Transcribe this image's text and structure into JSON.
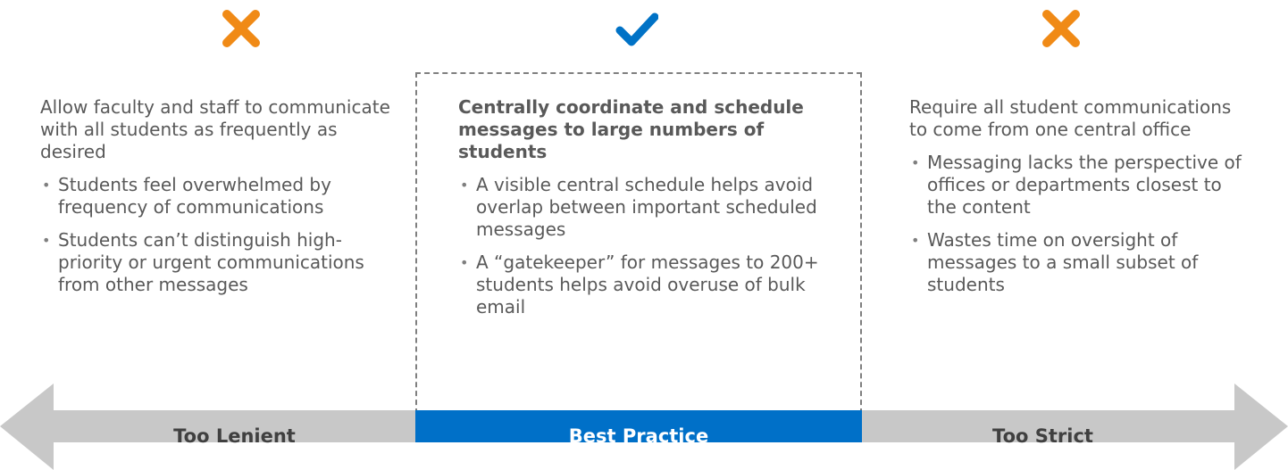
{
  "colors": {
    "cross": "#f08a16",
    "check": "#0072c6",
    "arrow_gray": "#c8c8c8",
    "best_blue": "#0070c8",
    "text": "#595959"
  },
  "icons": {
    "left": "x-mark-icon",
    "middle": "checkmark-icon",
    "right": "x-mark-icon"
  },
  "left": {
    "heading": "Allow faculty and staff to communicate with all students as frequently as desired",
    "bullets": [
      "Students feel overwhelmed by frequency of communications",
      "Students can’t distinguish high-priority or urgent communications from other messages"
    ],
    "label": "Too Lenient"
  },
  "middle": {
    "heading": "Centrally coordinate and schedule messages to large numbers of students",
    "bullets": [
      "A visible central schedule helps avoid overlap between important scheduled messages",
      "A “gatekeeper” for messages to 200+ students helps avoid overuse of bulk email"
    ],
    "label": "Best Practice"
  },
  "right": {
    "heading": "Require all student communications to come from one central office",
    "bullets": [
      "Messaging lacks the perspective of offices or departments closest to the content",
      "Wastes time on oversight of messages to a small subset of students"
    ],
    "label": "Too Strict"
  }
}
